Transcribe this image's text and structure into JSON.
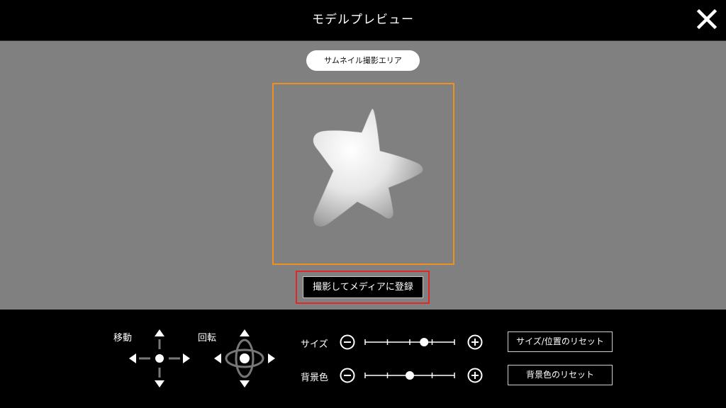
{
  "header": {
    "title": "モデルプレビュー"
  },
  "preview": {
    "area_label": "サムネイル撮影エリア"
  },
  "actions": {
    "capture_label": "撮影してメディアに登録"
  },
  "controls": {
    "move_label": "移動",
    "rotate_label": "回転",
    "size": {
      "label": "サイズ",
      "value_fraction": 0.66,
      "reset_label": "サイズ/位置のリセット"
    },
    "background": {
      "label": "背景色",
      "value_fraction": 0.5,
      "reset_label": "背景色のリセット"
    }
  },
  "icons": {
    "close": "close-icon",
    "move": "move-pad-icon",
    "rotate": "rotate-pad-icon",
    "minus": "minus-circle-icon",
    "plus": "plus-circle-icon"
  },
  "colors": {
    "frame": "#f0901e",
    "highlight": "#e02828",
    "background": "#808080"
  }
}
